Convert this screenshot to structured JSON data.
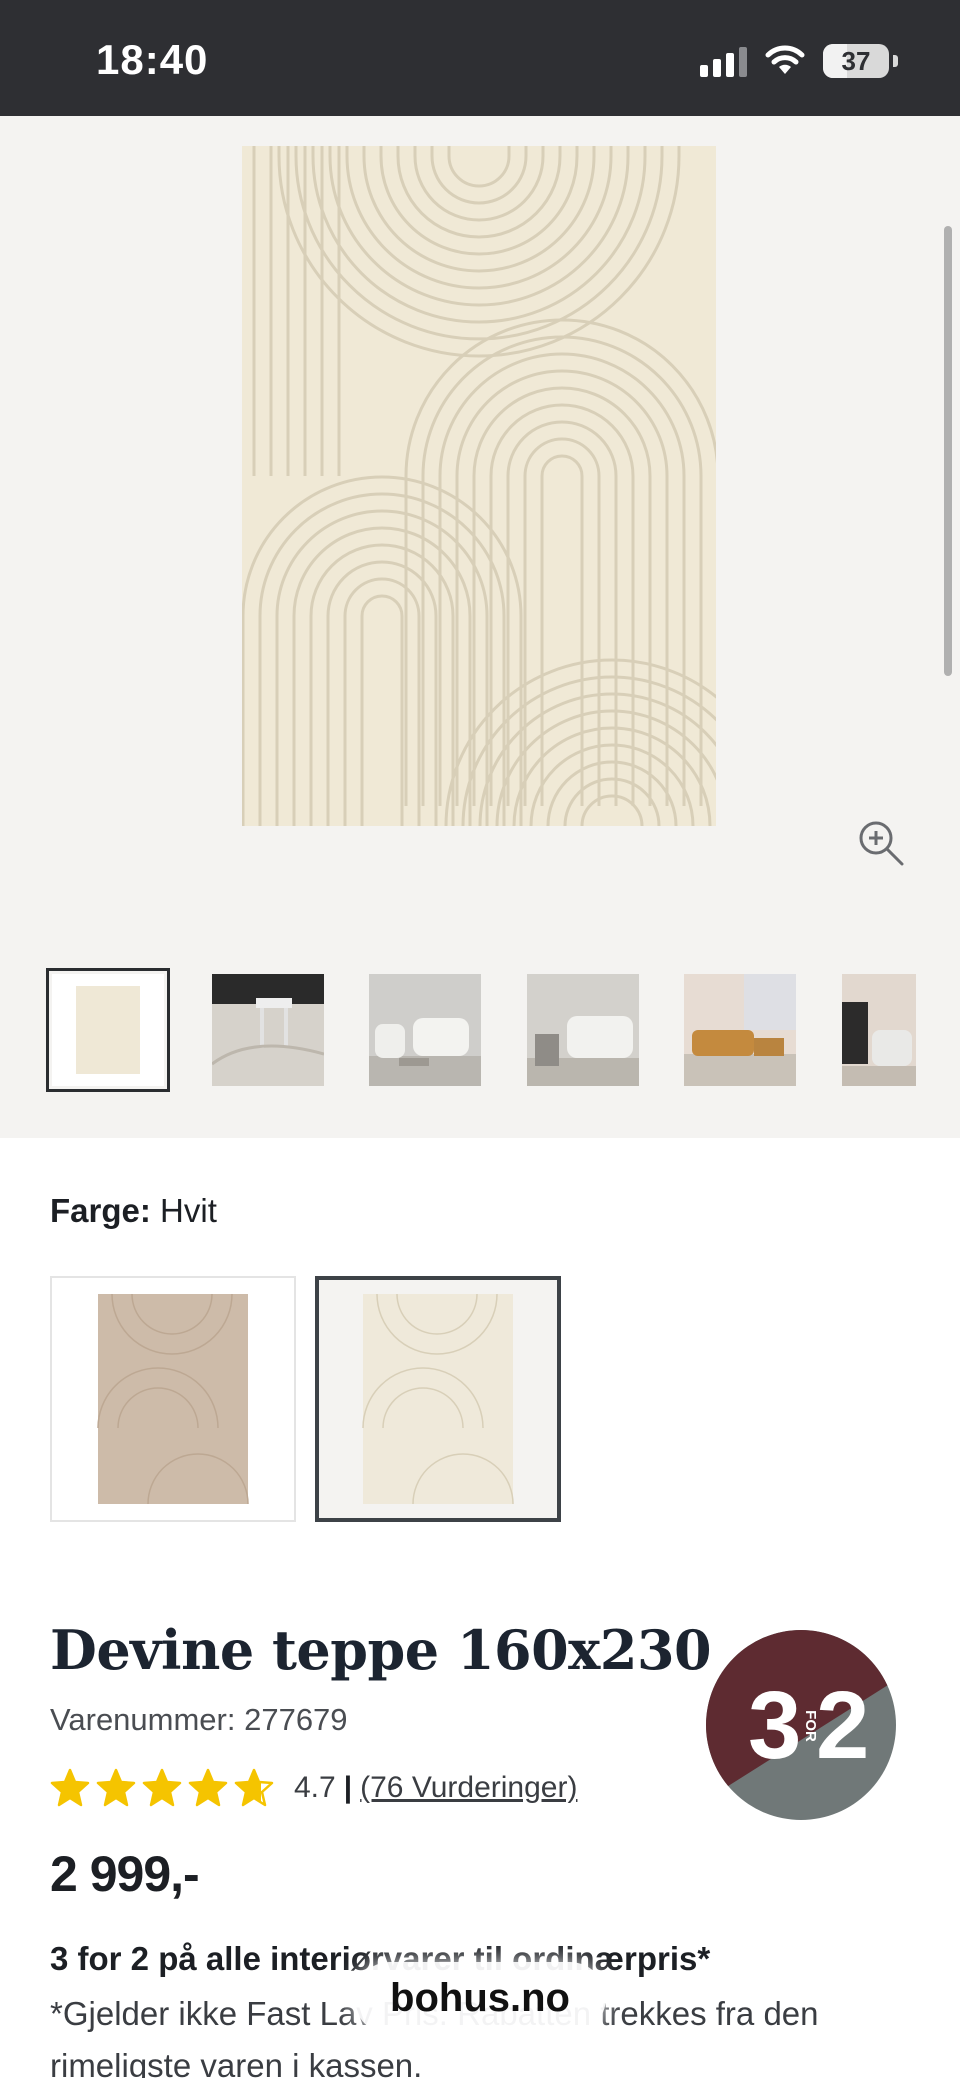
{
  "status_bar": {
    "time": "18:40",
    "battery_level": "37",
    "battery_fraction": 0.37,
    "icons": [
      "signal-icon",
      "wifi-icon",
      "battery-icon"
    ]
  },
  "gallery": {
    "main_image": "cream-rug-arch-pattern",
    "zoom_icon": "zoom-in-icon",
    "thumbnails": [
      "rug-front-view",
      "rug-with-side-table",
      "living-room-armchair-sofa",
      "living-room-sofa-side-table",
      "living-room-ochre-sofa",
      "armchair-and-cabinet"
    ],
    "selected_thumbnail_index": 0
  },
  "color_picker": {
    "label": "Farge:",
    "value": "Hvit",
    "options": [
      {
        "name": "beige-rug-swatch",
        "color": "#cdbba9"
      },
      {
        "name": "white-rug-swatch",
        "color": "#efe9da"
      }
    ],
    "selected_index": 1
  },
  "product": {
    "title": "Devine teppe 160x230",
    "sku_label": "Varenummer: 277679",
    "rating_value": "4.7",
    "rating_number": 4.7,
    "rating_separator": "|",
    "reviews_link": "(76 Vurderinger)",
    "price": "2 999,-"
  },
  "promo": {
    "headline": "3 for 2 på alle interiørvarer til ordinærpris*",
    "description": "*Gjelder ikke Fast Lav Pris. Rabatten trekkes fra den rimeligste varen i kassen.",
    "badge": {
      "left_number": "3",
      "middle_text": "FOR",
      "right_number": "2",
      "colors": {
        "top": "#5e2b31",
        "bottom": "#707878"
      }
    }
  },
  "browser": {
    "domain": "bohus.no"
  },
  "colors": {
    "star": "#f5c400",
    "status_bar_bg": "#2e2f33",
    "gallery_bg": "#f4f3f1",
    "title_text": "#1c2430"
  }
}
